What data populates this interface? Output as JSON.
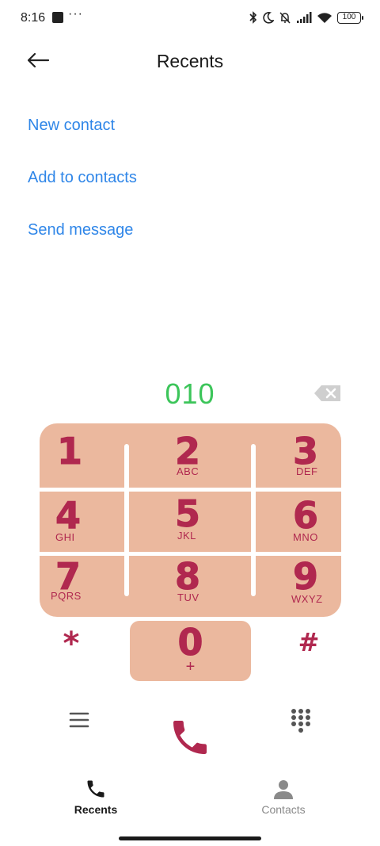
{
  "status_bar": {
    "time": "8:16",
    "dots": "···",
    "battery": "100",
    "icons": [
      "bluetooth-icon",
      "moon-icon",
      "bell-off-icon",
      "signal-icon",
      "wifi-icon",
      "battery-icon"
    ]
  },
  "header": {
    "title": "Recents",
    "back_icon": "arrow-left-icon"
  },
  "actions": {
    "new_contact": "New contact",
    "add_to_contacts": "Add to contacts",
    "send_message": "Send message"
  },
  "dialer": {
    "number": "010",
    "backspace_icon": "backspace-icon",
    "keys": [
      {
        "digit": "1",
        "letters": ""
      },
      {
        "digit": "2",
        "letters": "ABC"
      },
      {
        "digit": "3",
        "letters": "DEF"
      },
      {
        "digit": "4",
        "letters": "GHI"
      },
      {
        "digit": "5",
        "letters": "JKL"
      },
      {
        "digit": "6",
        "letters": "MNO"
      },
      {
        "digit": "7",
        "letters": "PQRS"
      },
      {
        "digit": "8",
        "letters": "TUV"
      },
      {
        "digit": "9",
        "letters": "WXYZ"
      }
    ],
    "star": "*",
    "zero": "0",
    "zero_sub": "+",
    "hash": "#"
  },
  "controls": {
    "menu_icon": "menu-icon",
    "call_icon": "phone-icon",
    "dialpad_icon": "dialpad-icon"
  },
  "bottom_nav": {
    "tabs": [
      {
        "label": "Recents",
        "icon": "phone-icon",
        "active": true
      },
      {
        "label": "Contacts",
        "icon": "person-icon",
        "active": false
      }
    ]
  },
  "colors": {
    "link": "#2f86e8",
    "number": "#3cc55a",
    "keypad_bg": "#ebb89e",
    "key_text": "#b0284f",
    "call": "#b0284f"
  }
}
